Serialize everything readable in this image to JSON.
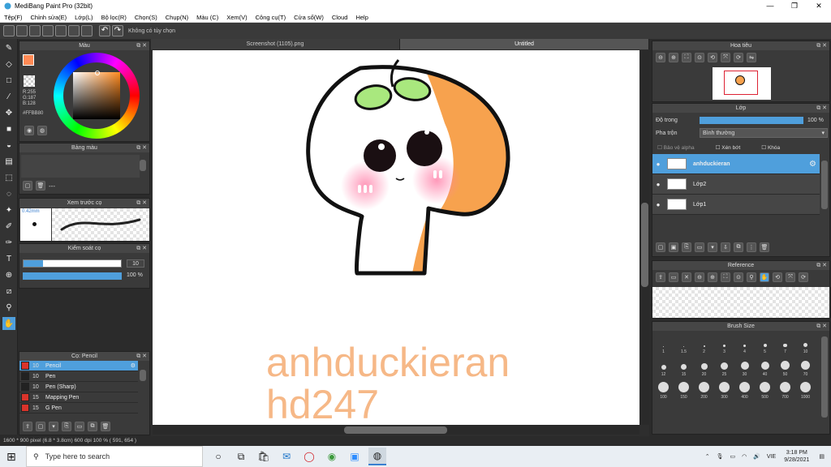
{
  "window": {
    "title": "MediBang Paint Pro (32bit)"
  },
  "menu": [
    "Tệp(F)",
    "Chỉnh sửa(E)",
    "Lớp(L)",
    "Bộ lọc(R)",
    "Chọn(S)",
    "Chụp(N)",
    "Màu (C)",
    "Xem(V)",
    "Công cụ(T)",
    "Cửa sổ(W)",
    "Cloud",
    "Help"
  ],
  "toolbar": {
    "option_text": "Không có tùy chọn"
  },
  "tabs": [
    "Screenshot (1105).png",
    "Untitled"
  ],
  "color_panel": {
    "title": "Màu",
    "r": "R:255",
    "g": "G:187",
    "b": "B:128",
    "hex": "#FFBB80",
    "fg_color": "#FFBB80"
  },
  "palette_panel": {
    "title": "Bảng màu",
    "placeholder": "---"
  },
  "brush_preview": {
    "title": "Xem trước cọ",
    "size": "0.42mm"
  },
  "brush_control": {
    "title": "Kiểm soát cọ",
    "size_value": "10",
    "opacity_value": "100 %"
  },
  "brush_list": {
    "title": "Cọ: Pencil",
    "items": [
      {
        "size": "10",
        "name": "Pencil",
        "color": "#d9342b",
        "selected": true
      },
      {
        "size": "10",
        "name": "Pen",
        "color": "#222222",
        "selected": false
      },
      {
        "size": "10",
        "name": "Pen (Sharp)",
        "color": "#222222",
        "selected": false
      },
      {
        "size": "15",
        "name": "Mapping Pen",
        "color": "#d9342b",
        "selected": false
      },
      {
        "size": "15",
        "name": "G Pen",
        "color": "#d9342b",
        "selected": false
      }
    ]
  },
  "watermark": {
    "line1": "anhduckieran",
    "line2": "hd247"
  },
  "statusbar": {
    "text": "1600 * 900 pixel   (6.8 * 3.8cm)   600 dpi   100 %   ( 591, 654 )"
  },
  "navigator": {
    "title": "Hoa tiêu"
  },
  "layer_panel": {
    "title": "Lớp",
    "opacity_label": "Độ trong",
    "opacity_value": "100 %",
    "blend_label": "Pha trộn",
    "blend_value": "Bình thường",
    "alpha_label": "Bảo vệ alpha",
    "clip_label": "Xén bớt",
    "lock_label": "Khóa",
    "layers": [
      {
        "name": "anhduckieran",
        "selected": true
      },
      {
        "name": "Lớp2",
        "selected": false
      },
      {
        "name": "Lớp1",
        "selected": false
      }
    ]
  },
  "reference": {
    "title": "Reference"
  },
  "brush_size": {
    "title": "Brush Size",
    "sizes": [
      "1",
      "1.5",
      "2",
      "3",
      "4",
      "5",
      "7",
      "10",
      "12",
      "15",
      "20",
      "25",
      "30",
      "40",
      "50",
      "70",
      "100",
      "150",
      "200",
      "300",
      "400",
      "500",
      "700",
      "1000"
    ]
  },
  "taskbar": {
    "search_placeholder": "Type here to search",
    "time": "3:18 PM",
    "date": "9/28/2021",
    "lang": "VIE"
  }
}
